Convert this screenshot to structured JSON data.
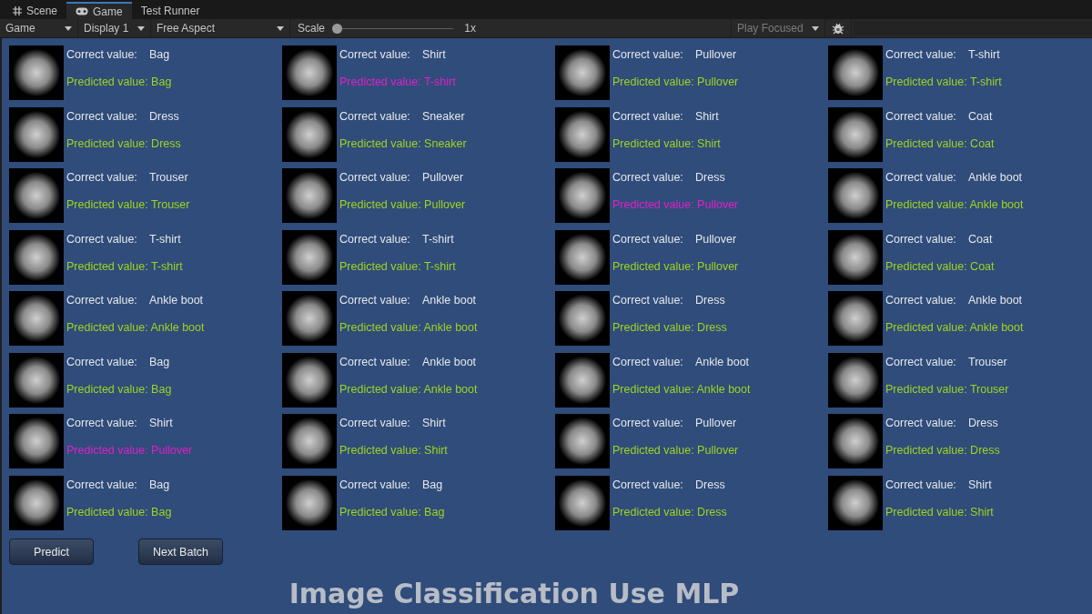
{
  "tabs": [
    {
      "label": "Scene",
      "kind": "grid",
      "selected": false
    },
    {
      "label": "Game",
      "kind": "gamepad",
      "selected": true
    },
    {
      "label": "Test Runner",
      "kind": "plain",
      "selected": false
    }
  ],
  "toolbar": {
    "view_dropdown": "Game",
    "display_dropdown": "Display 1",
    "aspect_dropdown": "Free Aspect",
    "scale_label": "Scale",
    "scale": {
      "level": 0,
      "reading": "1x"
    },
    "play_mode_dropdown": "Play Focused"
  },
  "results": [
    {
      "correct_label": "Correct value:",
      "correct": "Bag",
      "predicted": "Predicted value: Bag",
      "match": true
    },
    {
      "correct_label": "Correct value:",
      "correct": "Shirt",
      "predicted": "Predicted value: T-shirt",
      "match": false
    },
    {
      "correct_label": "Correct value:",
      "correct": "Pullover",
      "predicted": "Predicted value: Pullover",
      "match": true
    },
    {
      "correct_label": "Correct value:",
      "correct": "T-shirt",
      "predicted": "Predicted value: T-shirt",
      "match": true
    },
    {
      "correct_label": "Correct value:",
      "correct": "Dress",
      "predicted": "Predicted value: Dress",
      "match": true
    },
    {
      "correct_label": "Correct value:",
      "correct": "Sneaker",
      "predicted": "Predicted value: Sneaker",
      "match": true
    },
    {
      "correct_label": "Correct value:",
      "correct": "Shirt",
      "predicted": "Predicted value: Shirt",
      "match": true
    },
    {
      "correct_label": "Correct value:",
      "correct": "Coat",
      "predicted": "Predicted value: Coat",
      "match": true
    },
    {
      "correct_label": "Correct value:",
      "correct": "Trouser",
      "predicted": "Predicted value: Trouser",
      "match": true
    },
    {
      "correct_label": "Correct value:",
      "correct": "Pullover",
      "predicted": "Predicted value: Pullover",
      "match": true
    },
    {
      "correct_label": "Correct value:",
      "correct": "Dress",
      "predicted": "Predicted value: Pullover",
      "match": false
    },
    {
      "correct_label": "Correct value:",
      "correct": "Ankle boot",
      "predicted": "Predicted value: Ankle boot",
      "match": true
    },
    {
      "correct_label": "Correct value:",
      "correct": "T-shirt",
      "predicted": "Predicted value: T-shirt",
      "match": true
    },
    {
      "correct_label": "Correct value:",
      "correct": "T-shirt",
      "predicted": "Predicted value: T-shirt",
      "match": true
    },
    {
      "correct_label": "Correct value:",
      "correct": "Pullover",
      "predicted": "Predicted value: Pullover",
      "match": true
    },
    {
      "correct_label": "Correct value:",
      "correct": "Coat",
      "predicted": "Predicted value: Coat",
      "match": true
    },
    {
      "correct_label": "Correct value:",
      "correct": "Ankle boot",
      "predicted": "Predicted value: Ankle boot",
      "match": true
    },
    {
      "correct_label": "Correct value:",
      "correct": "Ankle boot",
      "predicted": "Predicted value: Ankle boot",
      "match": true
    },
    {
      "correct_label": "Correct value:",
      "correct": "Dress",
      "predicted": "Predicted value: Dress",
      "match": true
    },
    {
      "correct_label": "Correct value:",
      "correct": "Ankle boot",
      "predicted": "Predicted value: Ankle boot",
      "match": true
    },
    {
      "correct_label": "Correct value:",
      "correct": "Bag",
      "predicted": "Predicted value: Bag",
      "match": true
    },
    {
      "correct_label": "Correct value:",
      "correct": "Ankle boot",
      "predicted": "Predicted value: Ankle boot",
      "match": true
    },
    {
      "correct_label": "Correct value:",
      "correct": "Ankle boot",
      "predicted": "Predicted value: Ankle boot",
      "match": true
    },
    {
      "correct_label": "Correct value:",
      "correct": "Trouser",
      "predicted": "Predicted value: Trouser",
      "match": true
    },
    {
      "correct_label": "Correct value:",
      "correct": "Shirt",
      "predicted": "Predicted value: Pullover",
      "match": false
    },
    {
      "correct_label": "Correct value:",
      "correct": "Shirt",
      "predicted": "Predicted value: Shirt",
      "match": true
    },
    {
      "correct_label": "Correct value:",
      "correct": "Pullover",
      "predicted": "Predicted value: Pullover",
      "match": true
    },
    {
      "correct_label": "Correct value:",
      "correct": "Dress",
      "predicted": "Predicted value: Dress",
      "match": true
    },
    {
      "correct_label": "Correct value:",
      "correct": "Bag",
      "predicted": "Predicted value: Bag",
      "match": true
    },
    {
      "correct_label": "Correct value:",
      "correct": "Bag",
      "predicted": "Predicted value: Bag",
      "match": true
    },
    {
      "correct_label": "Correct value:",
      "correct": "Dress",
      "predicted": "Predicted value: Dress",
      "match": true
    },
    {
      "correct_label": "Correct value:",
      "correct": "Shirt",
      "predicted": "Predicted value: Shirt",
      "match": true
    }
  ],
  "buttons": [
    "Predict",
    "Next Batch"
  ],
  "title": "Image Classification Use MLP"
}
